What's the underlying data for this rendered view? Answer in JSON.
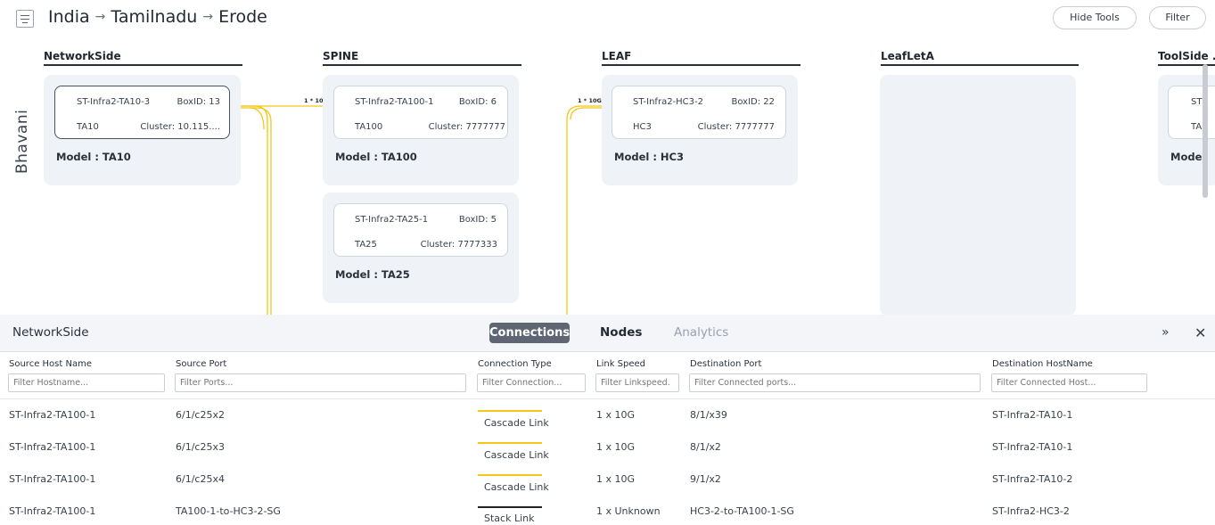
{
  "breadcrumb": [
    "India",
    "Tamilnadu",
    "Erode"
  ],
  "breadcrumb_separator": "→",
  "toolbar": {
    "hide_tools": "Hide Tools",
    "filter": "Filter"
  },
  "row_label": "Bhavani",
  "columns": [
    {
      "title": "NetworkSide"
    },
    {
      "title": "SPINE"
    },
    {
      "title": "LEAF"
    },
    {
      "title": "LeafLetA"
    },
    {
      "title": "ToolSide ..."
    }
  ],
  "nodes": {
    "ta10": {
      "host": "ST-Infra2-TA10-3",
      "box": "BoxID: 13",
      "type": "TA10",
      "cluster": "Cluster: 10.115....",
      "model": "Model : TA10"
    },
    "ta100": {
      "host": "ST-Infra2-TA100-1",
      "box": "BoxID: 6",
      "type": "TA100",
      "cluster": "Cluster: 7777777",
      "model": "Model : TA100"
    },
    "ta25": {
      "host": "ST-Infra2-TA25-1",
      "box": "BoxID: 5",
      "type": "TA25",
      "cluster": "Cluster: 7777333",
      "model": "Model : TA25"
    },
    "hc3": {
      "host": "ST-Infra2-HC3-2",
      "box": "BoxID: 22",
      "type": "HC3",
      "cluster": "Cluster: 7777777",
      "model": "Model : HC3"
    },
    "toolside": {
      "host": "ST",
      "type": "TA",
      "model": "Model"
    }
  },
  "link_speeds": {
    "spine": "1 * 10G",
    "leaf": "1 * 10G"
  },
  "colors": {
    "cascade": "#f5c518",
    "stack": "#222222",
    "tab_active": "#5d6672"
  },
  "panel": {
    "title": "NetworkSide",
    "tabs": {
      "connections": "Connections",
      "nodes": "Nodes",
      "analytics": "Analytics"
    },
    "collapse_icon": "»",
    "close_icon": "✕"
  },
  "table": {
    "headers": [
      "Source Host Name",
      "Source Port",
      "Connection Type",
      "Link Speed",
      "Destination Port",
      "Destination HostName"
    ],
    "filters": [
      "Filter Hostname...",
      "Filter Ports...",
      "Filter Connection...",
      "Filter Linkspeed.",
      "Filter Connected ports...",
      "Filter Connected Host..."
    ],
    "rows": [
      {
        "src_host": "ST-Infra2-TA100-1",
        "src_port": "6/1/c25x2",
        "type": "Cascade Link",
        "speed": "1 x 10G",
        "dst_port": "8/1/x39",
        "dst_host": "ST-Infra2-TA10-1"
      },
      {
        "src_host": "ST-Infra2-TA100-1",
        "src_port": "6/1/c25x3",
        "type": "Cascade Link",
        "speed": "1 x 10G",
        "dst_port": "8/1/x2",
        "dst_host": "ST-Infra2-TA10-1"
      },
      {
        "src_host": "ST-Infra2-TA100-1",
        "src_port": "6/1/c25x4",
        "type": "Cascade Link",
        "speed": "1 x 10G",
        "dst_port": "9/1/x2",
        "dst_host": "ST-Infra2-TA10-2"
      },
      {
        "src_host": "ST-Infra2-TA100-1",
        "src_port": "TA100-1-to-HC3-2-SG",
        "type": "Stack Link",
        "speed": "1 x Unknown",
        "dst_port": "HC3-2-to-TA100-1-SG",
        "dst_host": "ST-Infra2-HC3-2"
      }
    ]
  }
}
